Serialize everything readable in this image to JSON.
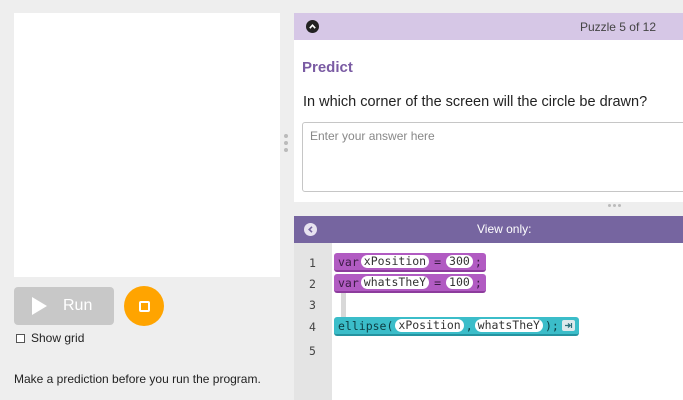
{
  "left_panel": {
    "run_label": "Run",
    "show_grid_label": "Show grid",
    "show_grid_checked": false,
    "prompt_text": "Make a prediction before you run the program."
  },
  "instructions": {
    "puzzle_label": "Puzzle 5 of 12",
    "title": "Predict",
    "question": "In which corner of the screen will the circle be drawn?",
    "answer_placeholder": "Enter your answer here"
  },
  "workspace": {
    "header_label": "View only:",
    "line_numbers": [
      "1",
      "2",
      "3",
      "4",
      "5"
    ],
    "code": {
      "line1": {
        "keyword": "var",
        "name": "xPosition",
        "op": "=",
        "value": "300",
        "end": ";"
      },
      "line2": {
        "keyword": "var",
        "name": "whatsTheY",
        "op": "=",
        "value": "100",
        "end": ";"
      },
      "line4": {
        "func": "ellipse",
        "open": "(",
        "arg1": "xPosition",
        "sep": ",",
        "arg2": "whatsTheY",
        "close": ");"
      }
    }
  },
  "colors": {
    "accent_purple": "#7665a0",
    "header_lavender": "#d6c7e6",
    "stop_orange": "#ffa400",
    "block_purple": "#b15bc2",
    "block_teal": "#3bbdc9"
  },
  "icons": {
    "collapse": "chevron-up-circle-icon",
    "back": "chevron-left-circle-icon",
    "run": "play-triangle-icon",
    "stop": "stop-square-icon",
    "end_block": "arrow-collapse-icon"
  }
}
